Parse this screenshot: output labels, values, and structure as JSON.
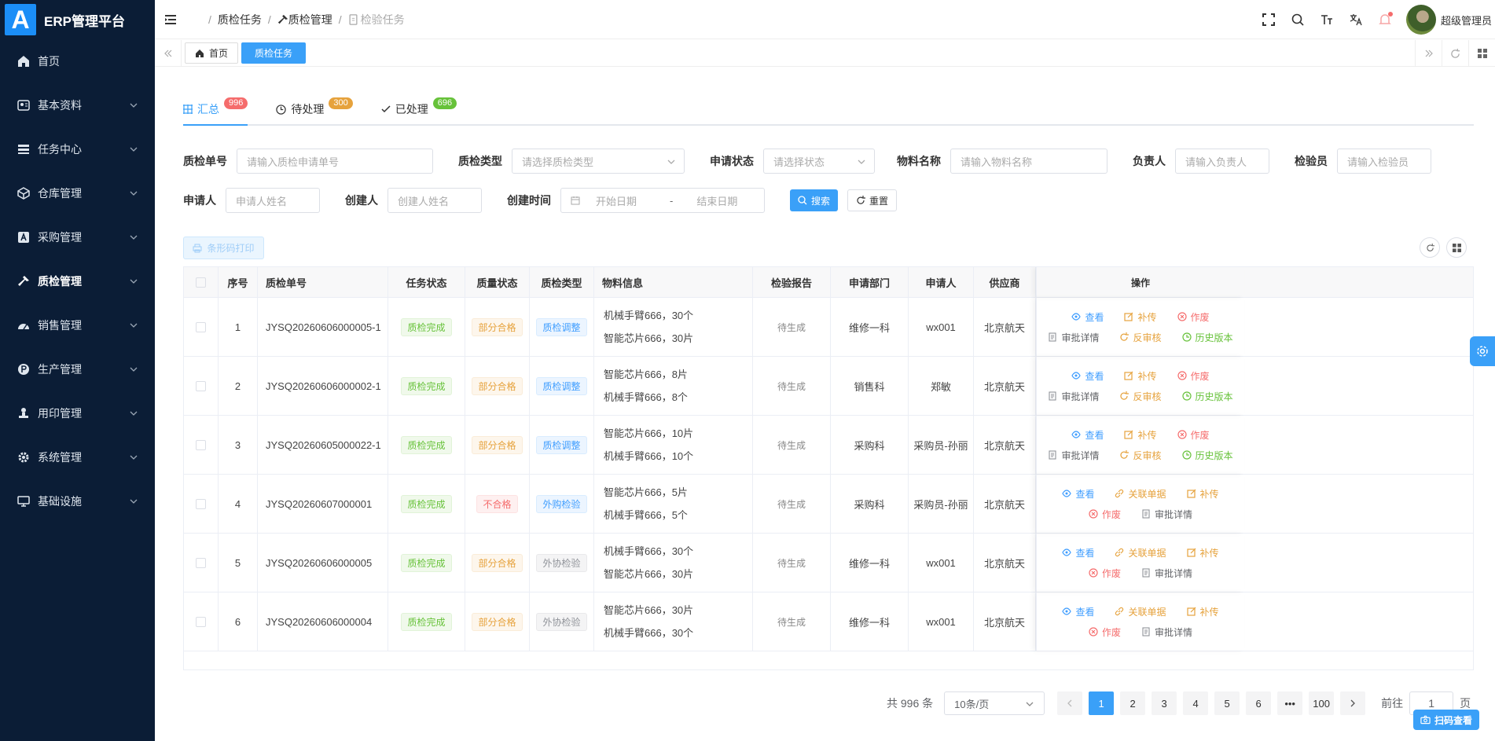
{
  "app": {
    "logo_letter": "A",
    "title": "ERP管理平台"
  },
  "sidebar": {
    "items": [
      {
        "label": "首页",
        "icon": "home-icon",
        "expandable": false
      },
      {
        "label": "基本资料",
        "icon": "profile-icon",
        "expandable": true
      },
      {
        "label": "任务中心",
        "icon": "task-icon",
        "expandable": true
      },
      {
        "label": "仓库管理",
        "icon": "warehouse-icon",
        "expandable": true
      },
      {
        "label": "采购管理",
        "icon": "purchase-icon",
        "expandable": true
      },
      {
        "label": "质检管理",
        "icon": "hammer-icon",
        "expandable": true,
        "active": true
      },
      {
        "label": "销售管理",
        "icon": "sales-icon",
        "expandable": true
      },
      {
        "label": "生产管理",
        "icon": "production-icon",
        "expandable": true
      },
      {
        "label": "用印管理",
        "icon": "seal-icon",
        "expandable": true
      },
      {
        "label": "系统管理",
        "icon": "gear-icon",
        "expandable": true
      },
      {
        "label": "基础设施",
        "icon": "monitor-icon",
        "expandable": true
      }
    ]
  },
  "breadcrumb": [
    "质检任务",
    "质检管理",
    "检验任务"
  ],
  "user": {
    "name": "超级管理员"
  },
  "tagsbar": {
    "tags": [
      "首页",
      "质检任务"
    ]
  },
  "tabs": [
    {
      "label": "汇总",
      "count": "996",
      "color": "#f56c6c"
    },
    {
      "label": "待处理",
      "count": "300",
      "color": "#e6a23c"
    },
    {
      "label": "已处理",
      "count": "696",
      "color": "#67c23a"
    }
  ],
  "filters": {
    "inspect_no": {
      "label": "质检单号",
      "placeholder": "请输入质检申请单号"
    },
    "inspect_type": {
      "label": "质检类型",
      "placeholder": "请选择质检类型"
    },
    "apply_status": {
      "label": "申请状态",
      "placeholder": "请选择状态"
    },
    "material": {
      "label": "物料名称",
      "placeholder": "请输入物料名称"
    },
    "owner": {
      "label": "负责人",
      "placeholder": "请输入负责人"
    },
    "inspector": {
      "label": "检验员",
      "placeholder": "请输入检验员"
    },
    "applicant": {
      "label": "申请人",
      "placeholder": "申请人姓名"
    },
    "creator": {
      "label": "创建人",
      "placeholder": "创建人姓名"
    },
    "created": {
      "label": "创建时间",
      "start": "开始日期",
      "sep": "-",
      "end": "结束日期"
    },
    "search_label": "搜索",
    "reset_label": "重置"
  },
  "print_label": "条形码打印",
  "table": {
    "headers": [
      "序号",
      "质检单号",
      "任务状态",
      "质量状态",
      "质检类型",
      "物料信息",
      "检验报告",
      "申请部门",
      "申请人",
      "供应商",
      "操作"
    ],
    "rows": [
      {
        "idx": "1",
        "no": "JYSQ20260606000005-1",
        "task": "质检完成",
        "quality": "部分合格",
        "qcolor": "orange",
        "type": "质检调整",
        "tcolor": "blue",
        "mat": [
          "机械手臂666，30个",
          "智能芯片666，30片"
        ],
        "report": "待生成",
        "dept": "维修一科",
        "applicant": "wx001",
        "supplier": "北京航天",
        "ops": "a"
      },
      {
        "idx": "2",
        "no": "JYSQ20260606000002-1",
        "task": "质检完成",
        "quality": "部分合格",
        "qcolor": "orange",
        "type": "质检调整",
        "tcolor": "blue",
        "mat": [
          "智能芯片666，8片",
          "机械手臂666，8个"
        ],
        "report": "待生成",
        "dept": "销售科",
        "applicant": "郑敏",
        "supplier": "北京航天",
        "ops": "a"
      },
      {
        "idx": "3",
        "no": "JYSQ20260605000022-1",
        "task": "质检完成",
        "quality": "部分合格",
        "qcolor": "orange",
        "type": "质检调整",
        "tcolor": "blue",
        "mat": [
          "智能芯片666，10片",
          "机械手臂666，10个"
        ],
        "report": "待生成",
        "dept": "采购科",
        "applicant": "采购员-孙丽",
        "supplier": "北京航天",
        "ops": "a"
      },
      {
        "idx": "4",
        "no": "JYSQ20260607000001",
        "task": "质检完成",
        "quality": "不合格",
        "qcolor": "red",
        "type": "外购检验",
        "tcolor": "blue",
        "mat": [
          "智能芯片666，5片",
          "机械手臂666，5个"
        ],
        "report": "待生成",
        "dept": "采购科",
        "applicant": "采购员-孙丽",
        "supplier": "北京航天",
        "ops": "b"
      },
      {
        "idx": "5",
        "no": "JYSQ20260606000005",
        "task": "质检完成",
        "quality": "部分合格",
        "qcolor": "orange",
        "type": "外协检验",
        "tcolor": "gray",
        "mat": [
          "机械手臂666，30个",
          "智能芯片666，30片"
        ],
        "report": "待生成",
        "dept": "维修一科",
        "applicant": "wx001",
        "supplier": "北京航天",
        "ops": "b"
      },
      {
        "idx": "6",
        "no": "JYSQ20260606000004",
        "task": "质检完成",
        "quality": "部分合格",
        "qcolor": "orange",
        "type": "外协检验",
        "tcolor": "gray",
        "mat": [
          "智能芯片666，30片",
          "机械手臂666，30个"
        ],
        "report": "待生成",
        "dept": "维修一科",
        "applicant": "wx001",
        "supplier": "北京航天",
        "ops": "b"
      }
    ],
    "ops_a": [
      [
        "查看",
        "补传",
        "作废"
      ],
      [
        "审批详情",
        "反审核",
        "历史版本"
      ]
    ],
    "ops_b": [
      [
        "查看",
        "关联单据",
        "补传"
      ],
      [
        "作废",
        "审批详情"
      ]
    ]
  },
  "pagination": {
    "total": "共 996 条",
    "page_size": "10条/页",
    "pages": [
      "1",
      "2",
      "3",
      "4",
      "5",
      "6",
      "•••",
      "100"
    ],
    "current": "1",
    "goto_label": "前往",
    "goto_value": "1",
    "page_unit": "页"
  },
  "scan_label": "扫码查看",
  "colors": {
    "sidebar_bg": "#0b1d36",
    "primary": "#3aa0f8"
  }
}
